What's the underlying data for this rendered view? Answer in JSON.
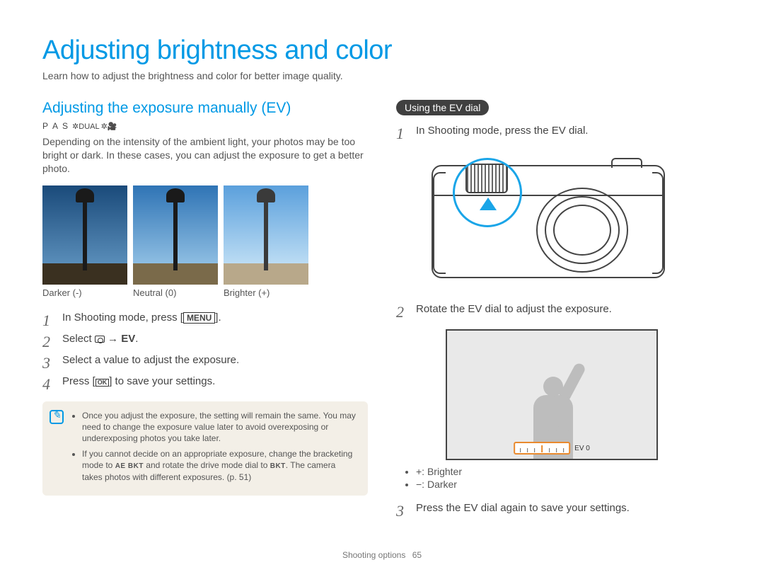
{
  "title": "Adjusting brightness and color",
  "intro": "Learn how to adjust the brightness and color for better image quality.",
  "left": {
    "subtitle": "Adjusting the exposure manually (EV)",
    "modes": [
      "P",
      "A",
      "S"
    ],
    "dual_label": "DUAL",
    "body": "Depending on the intensity of the ambient light, your photos may be too bright or dark. In these cases, you can adjust the exposure to get a better photo.",
    "exposures": [
      {
        "caption": "Darker (-)"
      },
      {
        "caption": "Neutral (0)"
      },
      {
        "caption": "Brighter (+)"
      }
    ],
    "steps": {
      "s1_pre": "In Shooting mode, press [",
      "s1_menu": "MENU",
      "s1_post": "].",
      "s2_pre": "Select ",
      "s2_arrow": " → ",
      "s2_ev": "EV",
      "s2_post": ".",
      "s3": "Select a value to adjust the exposure.",
      "s4_pre": "Press [",
      "s4_ok": "OK",
      "s4_post": "] to save your settings."
    },
    "note": {
      "bullet1": "Once you adjust the exposure, the setting will remain the same. You may need to change the exposure value later to avoid overexposing or underexposing photos you take later.",
      "bullet2_pre": "If you cannot decide on an appropriate exposure, change the bracketing mode to ",
      "bullet2_ae": "AE BKT",
      "bullet2_mid": " and rotate the drive mode dial to ",
      "bullet2_bkt": "BKT",
      "bullet2_post": ". The camera takes photos with different exposures. (p. 51)"
    }
  },
  "right": {
    "pill": "Using the EV dial",
    "steps": {
      "s1": "In Shooting mode, press the EV dial.",
      "s2": "Rotate the EV dial to adjust the exposure.",
      "s3": "Press the EV dial again to save your settings."
    },
    "ev_readout": "EV 0",
    "bullets": {
      "b1": "+: Brighter",
      "b2": "−: Darker"
    }
  },
  "footer": {
    "section": "Shooting options",
    "page": "65"
  }
}
